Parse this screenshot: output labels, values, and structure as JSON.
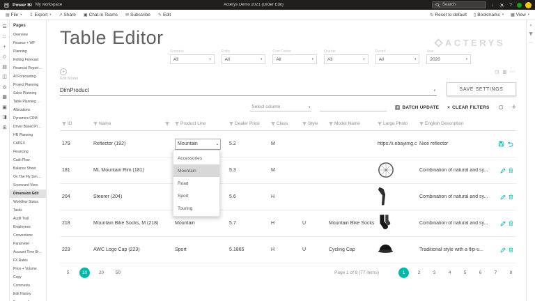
{
  "colors": {
    "accent": "#00b8aa",
    "avatar": "#f2c811",
    "presence": "#13a10e"
  },
  "topbar": {
    "brand": "Power BI",
    "workspace": "My workspace",
    "report_title": "Acterys Demo 2021 (Order Edit)",
    "search_placeholder": "Search",
    "icons": [
      {
        "name": "download-icon",
        "glyph": "↓"
      },
      {
        "name": "settings-icon",
        "svg": "gear"
      },
      {
        "name": "help-icon",
        "glyph": "?"
      }
    ]
  },
  "menubar": {
    "left": [
      {
        "label": "File",
        "icon": "file-icon",
        "caret": true
      },
      {
        "label": "Export",
        "icon": "export-icon",
        "caret": true
      },
      {
        "label": "Share",
        "icon": "share-icon"
      },
      {
        "label": "Chat in Teams",
        "icon": "teams-icon"
      },
      {
        "label": "Subscribe",
        "icon": "subscribe-icon"
      },
      {
        "label": "Edit",
        "icon": "edit-icon"
      }
    ],
    "right": [
      {
        "label": "Reset to default",
        "icon": "reset-icon"
      },
      {
        "label": "Bookmarks",
        "icon": "bookmark-icon",
        "caret": true
      },
      {
        "label": "View",
        "icon": "view-icon",
        "caret": true
      }
    ]
  },
  "left_nav": {
    "icons": [
      {
        "name": "menu-icon",
        "glyph": "☰"
      },
      {
        "name": "home-icon",
        "glyph": "⌂"
      },
      {
        "name": "create-icon",
        "glyph": "+"
      },
      {
        "name": "goals-icon",
        "glyph": "◇"
      },
      {
        "name": "browse-icon",
        "glyph": "▤"
      },
      {
        "name": "data-hub-icon",
        "glyph": "◫"
      },
      {
        "name": "metrics-icon",
        "glyph": "◎"
      },
      {
        "name": "monitor-icon",
        "glyph": "▦"
      },
      {
        "name": "apps-icon",
        "glyph": "▣"
      },
      {
        "name": "workspaces-icon",
        "glyph": "◨"
      },
      {
        "name": "my-workspace-icon",
        "glyph": "⊞"
      }
    ]
  },
  "pages": {
    "title": "Pages",
    "selected_index": 19,
    "items": [
      "Overview",
      "Finance + WF",
      "Planning",
      "Rolling Forecast",
      "Financial Reporting",
      "AI Forecasting",
      "Project Planning",
      "Sales Planning",
      "Table Planning Goals",
      "Allocations",
      "Dynamics CRM",
      "Driver Based Planning",
      "HR Planning",
      "CAPEX",
      "Financing",
      "Cash Flow",
      "Balance Sheet",
      "On The Fly Simulation",
      "Scorecard View",
      "Dimension Edit",
      "Workflow Status",
      "Tasks",
      "Audit Trail",
      "Employees",
      "Conventions",
      "Parameter",
      "Account Time Breakdo...",
      "FX Rates",
      "Price + Volume",
      "Copy",
      "Comments",
      "Edit History",
      "Expense Items"
    ]
  },
  "main": {
    "title": "Table Editor",
    "brand_logo": "ACTERYS",
    "slicers": [
      {
        "label": "Scenario",
        "value": "All"
      },
      {
        "label": "Entity",
        "value": "All"
      },
      {
        "label": "Cost Center",
        "value": "All"
      },
      {
        "label": "Quarter",
        "value": "All"
      },
      {
        "label": "Period",
        "value": "All"
      },
      {
        "label": "Year",
        "value": "2020"
      }
    ],
    "edit_model": {
      "label": "Edit Model",
      "value": "DimProduct",
      "save_button": "SAVE SETTINGS"
    },
    "toolbar": {
      "select_column_placeholder": "Select column",
      "batch_update": "BATCH UPDATE",
      "clear_filters": "CLEAR FILTERS"
    },
    "table": {
      "columns": [
        "ID",
        "Name",
        "",
        "Product Line",
        "Dealer Price",
        "Class",
        "Style",
        "Model Name",
        "Large Photo",
        "English Description"
      ],
      "rows": [
        {
          "id": "179",
          "name": "Reflector (192)",
          "product_line": "Mountain",
          "dealer_price": "5.2",
          "class": "M",
          "style": "",
          "model_name": "",
          "large_photo": "https://i.ebayimg.c...",
          "photo_icon": "",
          "description": "Nice reflector",
          "actions": [
            "save",
            "undo"
          ],
          "editing": true
        },
        {
          "id": "181",
          "name": "ML Mountain Rim (181)",
          "product_line": "",
          "dealer_price": "5.3",
          "class": "M",
          "style": "",
          "model_name": "",
          "large_photo": "",
          "photo_icon": "wheel",
          "description": "Combination of natural and sy...",
          "actions": [
            "edit",
            "delete"
          ],
          "editing": false
        },
        {
          "id": "204",
          "name": "Steerer (204)",
          "product_line": "",
          "dealer_price": "5.6",
          "class": "H",
          "style": "",
          "model_name": "",
          "large_photo": "",
          "photo_icon": "fork",
          "description": "Combination of natural and sy...",
          "actions": [
            "edit",
            "delete"
          ],
          "editing": false
        },
        {
          "id": "218",
          "name": "Mountain Bike Socks, M (218)",
          "product_line": "Mountain",
          "dealer_price": "5.7",
          "class": "H",
          "style": "U",
          "model_name": "Mountain Bike Socks",
          "large_photo": "",
          "photo_icon": "socks",
          "description": "Combination of natural and sy...",
          "actions": [
            "edit",
            "delete"
          ],
          "editing": false
        },
        {
          "id": "223",
          "name": "AWC Logo Cap (223)",
          "product_line": "Sport",
          "dealer_price": "5.1865",
          "class": "H",
          "style": "U",
          "model_name": "Cycling Cap",
          "large_photo": "",
          "photo_icon": "cap",
          "description": "Traditional style with a flip-u...",
          "actions": [
            "edit",
            "delete"
          ],
          "editing": false
        }
      ],
      "product_line_dropdown": {
        "open_for_row": "179",
        "value": "Mountain",
        "options": [
          "Accessories",
          "Mountain",
          "Road",
          "Sport",
          "Touring"
        ],
        "highlighted": "Mountain"
      }
    },
    "pagination": {
      "page_sizes": [
        "5",
        "10",
        "20",
        "50"
      ],
      "active_size": "10",
      "info": "Page 1 of 8 (77 items)",
      "pages": [
        "1",
        "2",
        "3",
        "4",
        "5",
        "6",
        "7",
        "8"
      ],
      "active_page": "1"
    }
  },
  "right_panel": {
    "icons": [
      {
        "name": "collapse-pane-icon",
        "glyph": "«"
      },
      {
        "name": "filter-funnel-icon",
        "svg": "funnel"
      },
      {
        "name": "more-options-icon",
        "glyph": "⋯"
      }
    ]
  }
}
